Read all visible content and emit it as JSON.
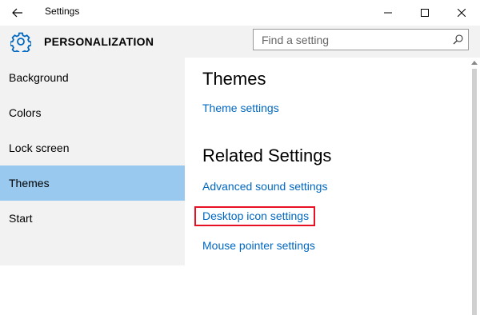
{
  "window": {
    "title": "Settings",
    "back_icon": "back-arrow-icon",
    "minimize_icon": "minimize-icon",
    "maximize_icon": "maximize-icon",
    "close_icon": "close-icon"
  },
  "header": {
    "icon": "gear-icon",
    "title": "PERSONALIZATION",
    "search": {
      "placeholder": "Find a setting",
      "value": "",
      "icon": "search-icon"
    }
  },
  "sidebar": {
    "items": [
      {
        "label": "Background",
        "selected": false
      },
      {
        "label": "Colors",
        "selected": false
      },
      {
        "label": "Lock screen",
        "selected": false
      },
      {
        "label": "Themes",
        "selected": true
      },
      {
        "label": "Start",
        "selected": false
      }
    ],
    "selected_color": "#99c9ef"
  },
  "main": {
    "section_title": "Themes",
    "theme_settings_link": "Theme settings",
    "related_title": "Related Settings",
    "related_links": [
      "Advanced sound settings",
      "Desktop icon settings",
      "Mouse pointer settings"
    ],
    "link_color": "#0067c0",
    "highlight_color": "#e81123"
  }
}
